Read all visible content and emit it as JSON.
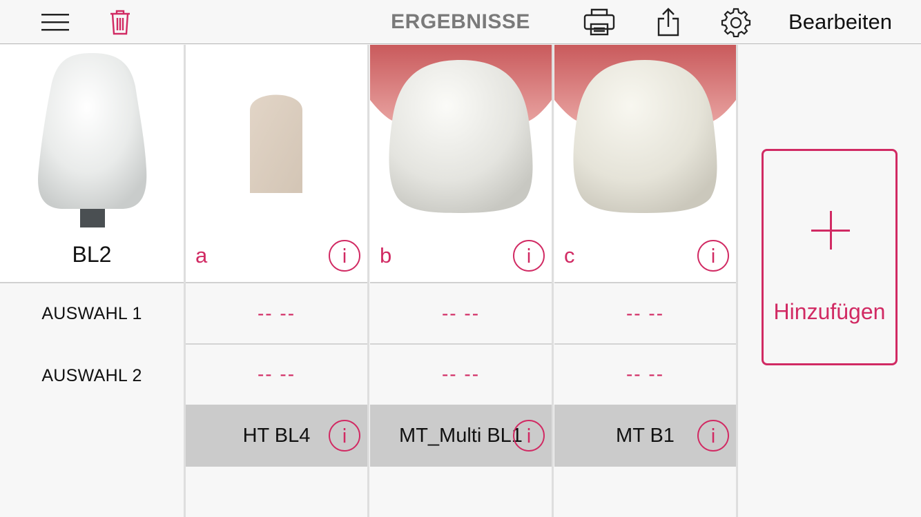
{
  "header": {
    "title": "ERGEBNISSE",
    "edit_label": "Bearbeiten",
    "icons": [
      "menu-icon",
      "trash-icon",
      "print-icon",
      "share-icon",
      "gear-icon"
    ]
  },
  "reference": {
    "shade": "BL2",
    "rows": [
      "AUSWAHL 1",
      "AUSWAHL 2"
    ]
  },
  "columns": [
    {
      "letter": "a",
      "auswahl1": "-- --",
      "auswahl2": "-- --",
      "result": "HT BL4"
    },
    {
      "letter": "b",
      "auswahl1": "-- --",
      "auswahl2": "-- --",
      "result": "MT_Multi BL1"
    },
    {
      "letter": "c",
      "auswahl1": "-- --",
      "auswahl2": "-- --",
      "result": "MT B1"
    }
  ],
  "info_glyph": "i",
  "add": {
    "label": "Hinzufügen"
  },
  "colors": {
    "accent": "#d12a63",
    "title": "#7a7a7a",
    "result_bg": "#cbcbcb"
  }
}
